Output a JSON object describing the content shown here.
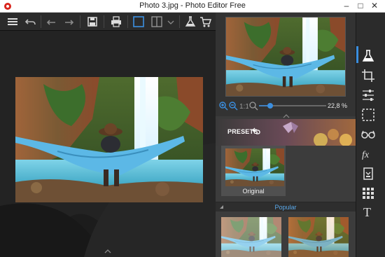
{
  "window": {
    "title": "Photo 3.jpg - Photo Editor Free",
    "minimize": "–",
    "maximize": "□",
    "close": "✕"
  },
  "toolbar": {
    "icons": [
      "menu-icon",
      "undo-icon",
      "redo-back-icon",
      "redo-icon",
      "save-icon",
      "print-icon",
      "single-view-icon",
      "compare-view-icon",
      "view-dropdown-icon",
      "effects-flask-icon",
      "cart-icon"
    ]
  },
  "navigator": {
    "zoom": "22,8 %",
    "zoom_icons": [
      "zoom-in-icon",
      "zoom-out-icon",
      "actual-size-icon",
      "fit-icon"
    ]
  },
  "presets": {
    "label": "PRESETS",
    "original": "Original",
    "category": "Popular"
  },
  "tools": [
    "flask-icon",
    "crop-icon",
    "adjust-sliders-icon",
    "selection-icon",
    "glasses-icon",
    "fx-icon",
    "retouch-icon",
    "grid-icon",
    "text-icon"
  ],
  "colors": {
    "accent": "#3b8fe0",
    "popular": "#5aa9ea",
    "hammock": "#5cb8e6"
  }
}
